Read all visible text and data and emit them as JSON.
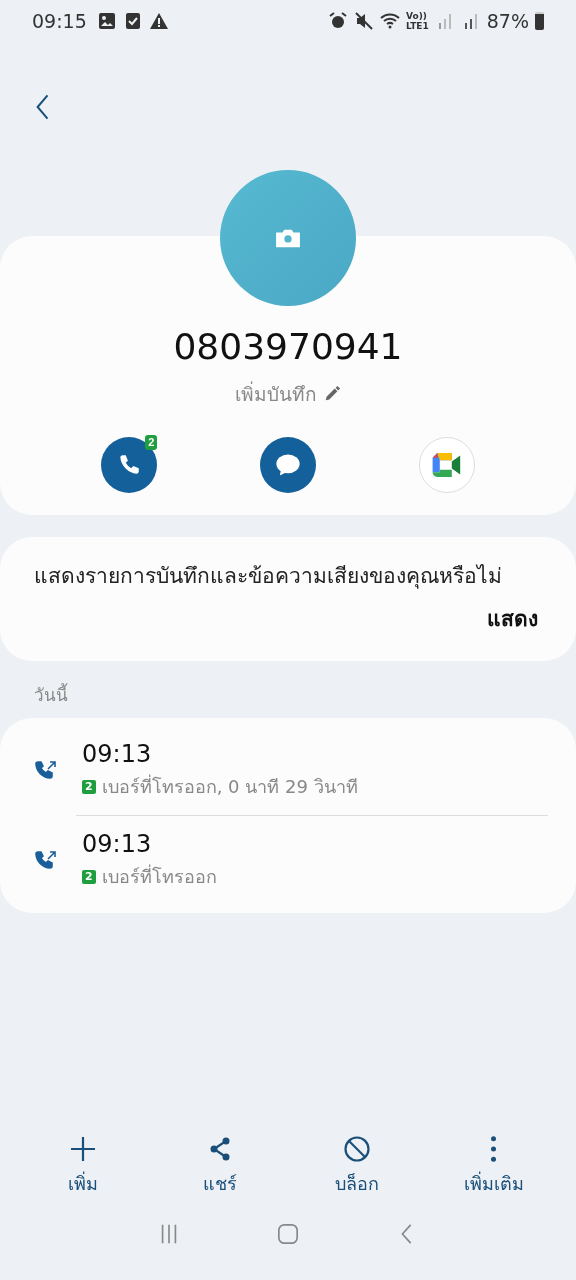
{
  "status_bar": {
    "time": "09:15",
    "volte": "Vo))",
    "network": "LTE1",
    "battery": "87%"
  },
  "contact": {
    "number": "0803970941",
    "note_label": "เพิ่มบันทึก"
  },
  "actions": [
    {
      "kind": "call",
      "badge": "2"
    },
    {
      "kind": "message"
    },
    {
      "kind": "video"
    }
  ],
  "prompt": {
    "text": "แสดงรายการบันทึกและข้อความเสียงของคุณหรือไม่",
    "button": "แสดง"
  },
  "section_title": "วันนี้",
  "calls": [
    {
      "time": "09:13",
      "sim": "2",
      "detail": "เบอร์ที่โทรออก, 0 นาที 29 วินาที"
    },
    {
      "time": "09:13",
      "sim": "2",
      "detail": "เบอร์ที่โทรออก"
    }
  ],
  "bottom_bar": [
    {
      "kind": "add",
      "label": "เพิ่ม"
    },
    {
      "kind": "share",
      "label": "แชร์"
    },
    {
      "kind": "block",
      "label": "บล็อก"
    },
    {
      "kind": "more",
      "label": "เพิ่มเติม"
    }
  ]
}
